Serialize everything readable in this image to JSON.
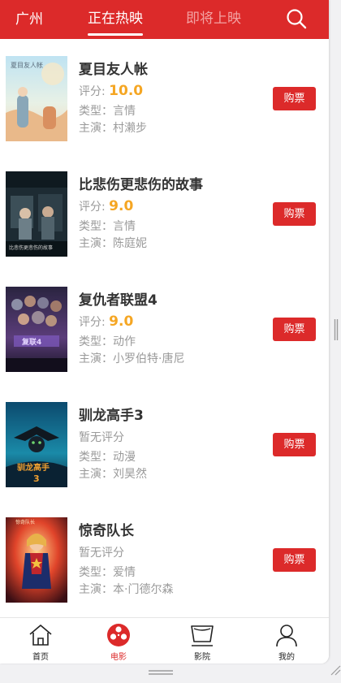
{
  "header": {
    "city": "广州",
    "tabs": [
      {
        "label": "正在热映",
        "active": true
      },
      {
        "label": "即将上映",
        "active": false
      }
    ],
    "search_icon": "search-icon"
  },
  "movies": [
    {
      "title": "夏目友人帐",
      "score_label": "评分:",
      "score": "10.0",
      "genre": "类型：言情",
      "cast": "主演：村濑步",
      "buy": "购票"
    },
    {
      "title": "比悲伤更悲伤的故事",
      "score_label": "评分:",
      "score": "9.0",
      "genre": "类型：言情",
      "cast": "主演：陈庭妮",
      "buy": "购票"
    },
    {
      "title": "复仇者联盟4",
      "score_label": "评分:",
      "score": "9.0",
      "genre": "类型：动作",
      "cast": "主演：小罗伯特·唐尼",
      "buy": "购票"
    },
    {
      "title": "驯龙高手3",
      "score_label": "暂无评分",
      "score": "",
      "genre": "类型：动漫",
      "cast": "主演：刘昊然",
      "buy": "购票"
    },
    {
      "title": "惊奇队长",
      "score_label": "暂无评分",
      "score": "",
      "genre": "类型：爱情",
      "cast": "主演：本·门德尔森",
      "buy": "购票"
    }
  ],
  "tabbar": [
    {
      "label": "首页",
      "icon": "home-icon",
      "active": false
    },
    {
      "label": "电影",
      "icon": "film-reel-icon",
      "active": true
    },
    {
      "label": "影院",
      "icon": "cinema-screen-icon",
      "active": false
    },
    {
      "label": "我的",
      "icon": "user-icon",
      "active": false
    }
  ],
  "colors": {
    "accent": "#dc2a2a",
    "score": "#f5a623",
    "inactive_tab": "#f3a2a2"
  }
}
